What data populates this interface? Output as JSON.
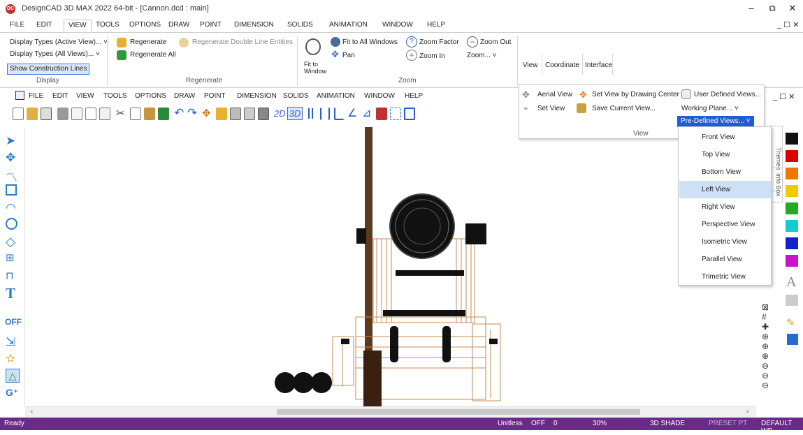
{
  "app": {
    "title": "DesignCAD 3D MAX 2022 64-bit - [Cannon.dcd : main]",
    "logo_text": "DC"
  },
  "window_controls": {
    "minimize": "–",
    "restore": "⧉",
    "close": "✕",
    "doc_controls": "_ ☐ ✕"
  },
  "menubar": {
    "items": [
      "FILE",
      "EDIT",
      "VIEW",
      "TOOLS",
      "OPTIONS",
      "DRAW",
      "POINT",
      "DIMENSION",
      "SOLIDS",
      "ANIMATION",
      "WINDOW",
      "HELP"
    ],
    "active": "VIEW"
  },
  "ribbon": {
    "display": {
      "types_active": "Display Types (Active View)... ˅",
      "types_all": "Display Types (All Views)... ˅",
      "show_construction": "Show Construction Lines",
      "group_label": "Display"
    },
    "regenerate": {
      "regenerate": "Regenerate",
      "regenerate_all": "Regenerate All",
      "regenerate_double": "Regenerate Double Line Entities",
      "group_label": "Regenerate"
    },
    "zoom": {
      "fit_to_window": "Fit to Window",
      "fit_all": "Fit to All Windows",
      "pan": "Pan",
      "zoom_factor": "Zoom Factor",
      "zoom_in": "Zoom In",
      "zoom_out": "Zoom Out",
      "zoom_menu": "Zoom... ˅",
      "group_label": "Zoom"
    },
    "view_tabs": {
      "view": "View",
      "coordinate": "Coordinate",
      "interface": "Interface"
    }
  },
  "secondary_menubar": {
    "items": [
      "FILE",
      "EDIT",
      "VIEW",
      "TOOLS",
      "OPTIONS",
      "DRAW",
      "POINT",
      "DIMENSION",
      "SOLIDS",
      "ANIMATION",
      "WINDOW",
      "HELP"
    ]
  },
  "toolbar2": {
    "mode_2d": "2D",
    "mode_3d": "3D"
  },
  "view_panel": {
    "aerial_view": "Aerial View",
    "set_view_center": "Set View by Drawing Center",
    "user_defined": "User Defined Views...",
    "set_view": "Set View",
    "save_current": "Save Current View...",
    "working_plane": "Working Plane... ˅",
    "predefined": "Pre-Defined Views... ˅",
    "group_label": "View"
  },
  "predefined_views": {
    "items": [
      "Front View",
      "Top View",
      "Bottom View",
      "Left View",
      "Right View",
      "Perspective View",
      "Isometric View",
      "Parallel View",
      "Trimetric View"
    ],
    "hovered": "Left View"
  },
  "side_tabs": {
    "themes": "Themes",
    "info_box": "Info Box"
  },
  "left_toolbar": {
    "off_label": "OFF"
  },
  "status": {
    "ready": "Ready",
    "units": "Unitless",
    "snap": "OFF",
    "snap_value": "0",
    "zoom": "30%",
    "shade": "3D SHADE",
    "preset": "PRESET PT",
    "workplane": "DEFAULT WP"
  },
  "colors": {
    "swatches": [
      "#111111",
      "#dd0000",
      "#ee7700",
      "#eecc00",
      "#22aa22",
      "#11cccc",
      "#1122cc",
      "#cc11cc"
    ],
    "status_bar": "#6a2a8a",
    "accent": "#1e5ed1"
  }
}
